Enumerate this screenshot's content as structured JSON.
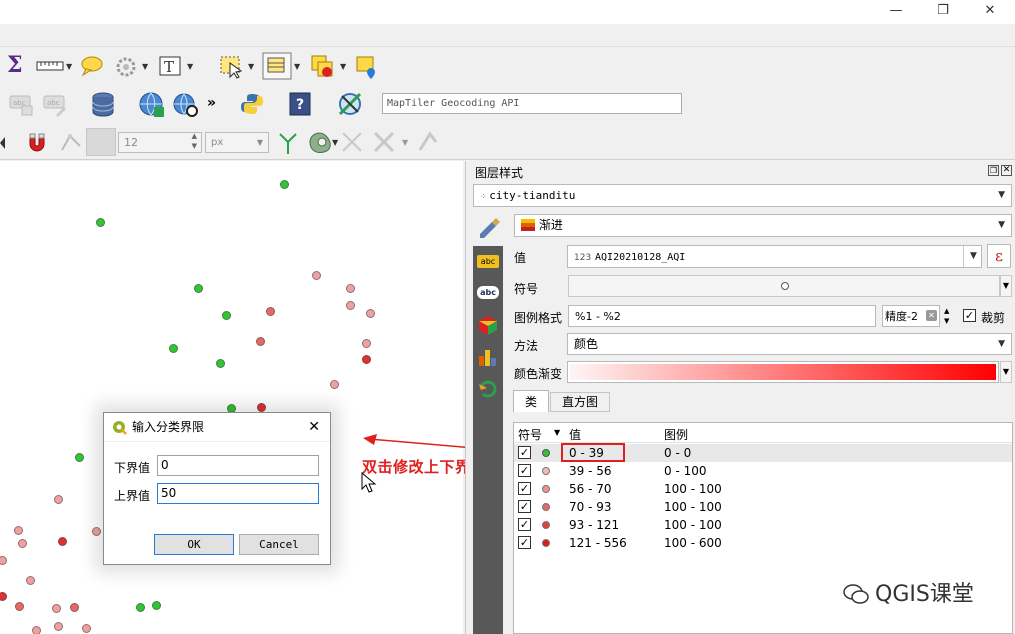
{
  "window": {
    "minimize_icon": "—",
    "restore_icon": "❐",
    "close_icon": "✕"
  },
  "toolbar": {
    "spin_value": "12",
    "unit_value": "px",
    "geocode_placeholder": "MapTiler Geocoding API"
  },
  "dialog": {
    "title": "输入分类界限",
    "lower_label": "下界值",
    "lower_value": "0",
    "upper_label": "上界值",
    "upper_value": "50",
    "ok_label": "OK",
    "cancel_label": "Cancel"
  },
  "annotation": {
    "text": "双击修改上下界翻"
  },
  "panel": {
    "title": "图层样式",
    "layer": "city-tianditu",
    "renderer": "渐进",
    "value_label": "值",
    "value_field": "AQI20210128_AQI",
    "value_type": "123",
    "symbol_label": "符号",
    "legend_format_label": "图例格式",
    "legend_format_value": "%1 - %2",
    "precision_value": "精度-2",
    "clip_label": "裁剪",
    "method_label": "方法",
    "method_value": "颜色",
    "ramp_label": "颜色渐变",
    "tabs": [
      "类",
      "直方图"
    ],
    "table_headers": {
      "symbol": "符号",
      "value": "值",
      "legend": "图例"
    },
    "rows": [
      {
        "value": "0 - 39",
        "legend": "0 - 0",
        "color": "#33c433"
      },
      {
        "value": "39 - 56",
        "legend": "0 - 100",
        "color": "#f5b8b8"
      },
      {
        "value": "56 - 70",
        "legend": "100 - 100",
        "color": "#f09090"
      },
      {
        "value": "70 - 93",
        "legend": "100 - 100",
        "color": "#e86868"
      },
      {
        "value": "93 - 121",
        "legend": "100 - 100",
        "color": "#e04040"
      },
      {
        "value": "121 - 556",
        "legend": "100 - 600",
        "color": "#d42020"
      }
    ]
  },
  "watermark": {
    "text": "QGIS课堂"
  },
  "colors": {
    "accent": "#e02020",
    "highlight_box": "#e02020",
    "sidebar": "#585858"
  }
}
